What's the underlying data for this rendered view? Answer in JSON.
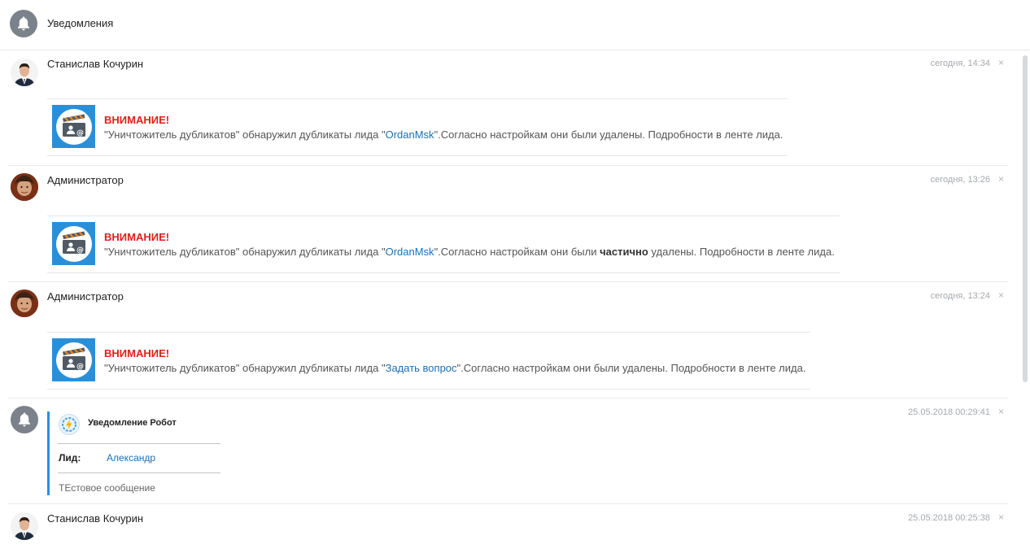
{
  "header": {
    "title": "Уведомления"
  },
  "notifications": [
    {
      "author": "Станислав Кочурин",
      "time": "сегодня, 14:34",
      "close": "×",
      "warning": "ВНИМАНИЕ!",
      "msg_before": "\"Уничтожитель дубликатов\" обнаружил дубликаты лида \"",
      "link": "OrdanMsk",
      "msg_after": "\".Согласно настройкам они были удалены. Подробности в ленте лида."
    },
    {
      "author": "Администратор",
      "time": "сегодня, 13:26",
      "close": "×",
      "warning": "ВНИМАНИЕ!",
      "msg_before": "\"Уничтожитель дубликатов\" обнаружил дубликаты лида \"",
      "link": "OrdanMsk",
      "msg_middle": "\".Согласно настройкам они были ",
      "bold": "частично",
      "msg_after": " удалены. Подробности в ленте лида."
    },
    {
      "author": "Администратор",
      "time": "сегодня, 13:24",
      "close": "×",
      "warning": "ВНИМАНИЕ!",
      "msg_before": "\"Уничтожитель дубликатов\" обнаружил дубликаты лида \"",
      "link": "Задать вопрос",
      "msg_after": "\".Согласно настройкам они были удалены. Подробности в ленте лида."
    },
    {
      "time": "25.05.2018 00:29:41",
      "close": "×",
      "robot_title": "Уведомление Робот",
      "lead_label": "Лид:",
      "lead_value": "Александр",
      "text": "ТЕстовое сообщение"
    },
    {
      "author": "Станислав Кочурин",
      "time": "25.05.2018 00:25:38",
      "close": "×"
    }
  ],
  "icons": {
    "bell": "bell-icon",
    "card": "clapperboard-contact-icon",
    "robot": "lightning-gear-icon"
  },
  "colors": {
    "warning": "#e0201b",
    "link": "#1d6fb3",
    "accent": "#2f8ee0",
    "bell_bg": "#7b828b"
  }
}
